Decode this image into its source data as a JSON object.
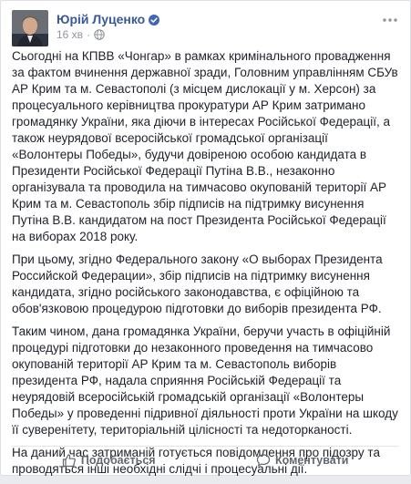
{
  "post": {
    "author": "Юрій Луценко",
    "time": "16 хв",
    "paragraphs": [
      "Сьогодні на КПВВ «Чонгар» в рамках кримінального провадження за фактом вчинення державної зради, Головним управлінням СБУв АР Крим та м. Севастополі (з місцем дислокації у м. Херсон) за процесуального керівництва прокуратури АР Крим затримано громадянку України, яка діючи в інтересах Російської Федерації, а також неурядової всеросійської громадської організації «Волонтеры Победы», будучи довіреною особою кандидата в Президенти Російської Федерації Путіна В.В., незаконно організувала та проводила на тимчасово окупованій території АР Крим та м. Севастополь збір підписів на підтримку висунення Путіна В.В. кандидатом на пост Президента Російської Федерації на виборах 2018 року.",
      "При цьому, згідно Федерального закону «О выборах Президента Российской Федерации», збір підписів на підтримку висунення кандидата, згідно російського законодавства, є офіційною та обов'язковою процедурою підготовки до виборів президента РФ.",
      "Таким чином, дана громадянка України, беручи участь в офіційній процедурі підготовки до незаконного проведення на тимчасово окупованій території АР Крим та м. Севастополь виборів президента РФ, надала сприяння Російській Федерації та неурядовій всеросійській громадській організації «Волонтеры Победы» у проведенні підривної діяльності проти України на шкоду її суверенітету, територіальній цілісності та недоторканості.",
      "На даний час затриманій готується повідомлення про підозру та проводяться інші необхідні слідчі і процесуальні дії."
    ]
  },
  "actions": {
    "like_label": "Подобається",
    "comment_label": "Коментувати"
  },
  "icons": {
    "verified": "verified-badge-icon",
    "privacy": "globe-icon",
    "more": "more-options-icon",
    "like": "thumbs-up-icon",
    "comment": "comment-icon"
  },
  "colors": {
    "author_link": "#385898",
    "verified": "#4267b2",
    "meta_text": "#90949c",
    "action_text": "#606770"
  }
}
